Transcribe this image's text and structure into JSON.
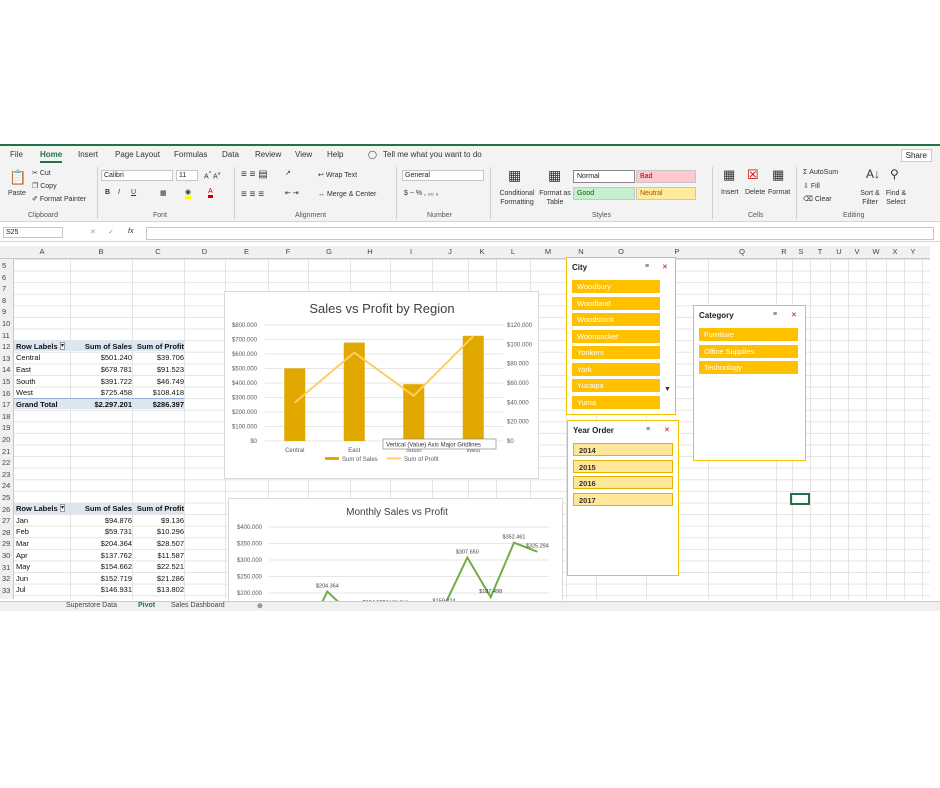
{
  "menu": {
    "tabs": [
      "File",
      "Home",
      "Insert",
      "Page Layout",
      "Formulas",
      "Data",
      "Review",
      "View",
      "Help"
    ],
    "tell_me": "Tell me what you want to do",
    "share": "Share"
  },
  "ribbon": {
    "clipboard": {
      "paste": "Paste",
      "cut": "Cut",
      "copy": "Copy",
      "format_painter": "Format Painter",
      "label": "Clipboard"
    },
    "font": {
      "name": "Calibri",
      "size": "11",
      "bold": "B",
      "italic": "I",
      "underline": "U",
      "label": "Font"
    },
    "alignment": {
      "wrap": "Wrap Text",
      "merge": "Merge & Center",
      "label": "Alignment"
    },
    "number": {
      "format": "General",
      "label": "Number"
    },
    "styles": {
      "conditional": "Conditional Formatting",
      "format_table": "Format as Table",
      "normal": "Normal",
      "bad": "Bad",
      "good": "Good",
      "neutral": "Neutral",
      "label": "Styles"
    },
    "cells": {
      "insert": "Insert",
      "delete": "Delete",
      "format": "Format",
      "label": "Cells"
    },
    "editing": {
      "autosum": "AutoSum",
      "fill": "Fill",
      "clear": "Clear",
      "sort": "Sort & Filter",
      "find": "Find & Select",
      "label": "Editing"
    }
  },
  "formula_bar": {
    "name_box": "S25",
    "fx": "fx",
    "value": ""
  },
  "columns": [
    "A",
    "B",
    "C",
    "D",
    "E",
    "F",
    "G",
    "H",
    "I",
    "J",
    "K",
    "L",
    "M",
    "N",
    "O",
    "P",
    "Q",
    "R",
    "S",
    "T",
    "U",
    "V",
    "W",
    "X",
    "Y"
  ],
  "rows": [
    "5",
    "6",
    "7",
    "8",
    "9",
    "10",
    "11",
    "12",
    "13",
    "14",
    "15",
    "16",
    "17",
    "18",
    "19",
    "20",
    "21",
    "22",
    "23",
    "24",
    "25",
    "26",
    "27",
    "28",
    "29",
    "30",
    "31",
    "32",
    "33"
  ],
  "pivot1": {
    "headers": [
      "Row Labels",
      "Sum of Sales",
      "Sum of Profit"
    ],
    "rows": [
      [
        "Central",
        "$501.240",
        "$39.706"
      ],
      [
        "East",
        "$678.781",
        "$91.523"
      ],
      [
        "South",
        "$391.722",
        "$46.749"
      ],
      [
        "West",
        "$725.458",
        "$108.418"
      ]
    ],
    "total": [
      "Grand Total",
      "$2.297.201",
      "$286.397"
    ]
  },
  "pivot2": {
    "headers": [
      "Row Labels",
      "Sum of Sales",
      "Sum of Profit"
    ],
    "rows": [
      [
        "Jan",
        "$94.876",
        "$9.136"
      ],
      [
        "Feb",
        "$59.731",
        "$10.296"
      ],
      [
        "Mar",
        "$204.364",
        "$28.507"
      ],
      [
        "Apr",
        "$137.762",
        "$11.587"
      ],
      [
        "May",
        "$154.662",
        "$22.521"
      ],
      [
        "Jun",
        "$152.719",
        "$21.286"
      ],
      [
        "Jul",
        "$146.931",
        "$13.802"
      ]
    ]
  },
  "chart_data": [
    {
      "type": "bar",
      "title": "Sales vs Profit by Region",
      "categories": [
        "Central",
        "East",
        "South",
        "West"
      ],
      "series": [
        {
          "name": "Sum of Sales",
          "values": [
            501240,
            678781,
            391722,
            725458
          ],
          "color": "#e1a800"
        },
        {
          "name": "Sum of Profit",
          "values": [
            39706,
            91523,
            46749,
            108418
          ],
          "color": "#ffcc66",
          "axis": "secondary"
        }
      ],
      "y_ticks": [
        "$0",
        "$100.000",
        "$200.000",
        "$300.000",
        "$400.000",
        "$500.000",
        "$600.000",
        "$700.000",
        "$800.000"
      ],
      "y2_ticks": [
        "$0",
        "$20.000",
        "$40.000",
        "$60.000",
        "$80.000",
        "$100.000",
        "$120.000"
      ],
      "ylim": [
        0,
        800000
      ],
      "y2lim": [
        0,
        120000
      ],
      "tooltip": "Vertical (Value) Axis Major Gridlines",
      "legend": "bottom"
    },
    {
      "type": "line",
      "title": "Monthly Sales vs Profit",
      "x_count": 12,
      "series": [
        {
          "name": "Sum of Sales",
          "values": [
            94876,
            59731,
            204364,
            137762,
            154662,
            152719,
            146931,
            159024,
            307650,
            187498,
            352461,
            325294
          ],
          "color": "#70ad47"
        }
      ],
      "labels": [
        "$204.364",
        "$154.662",
        "$152.719",
        "$146.931",
        "$159.024",
        "$307.650",
        "$187.498",
        "$352.461",
        "$325.294"
      ],
      "y_ticks": [
        "$200.000",
        "$250.000",
        "$300.000",
        "$350.000",
        "$400.000"
      ],
      "ylim": [
        200000,
        400000
      ]
    }
  ],
  "slicers": {
    "city": {
      "title": "City",
      "items": [
        "Woodbury",
        "Woodland",
        "Woodstock",
        "Woonsocket",
        "Yonkers",
        "York",
        "Yucaipa",
        "Yuma"
      ]
    },
    "category": {
      "title": "Category",
      "items": [
        "Furniture",
        "Office Supplies",
        "Technology"
      ]
    },
    "year": {
      "title": "Year Order",
      "items": [
        "2014",
        "2015",
        "2016",
        "2017"
      ]
    }
  },
  "sheets": [
    "Superstore Data",
    "Pivot",
    "Sales Dashboard"
  ]
}
